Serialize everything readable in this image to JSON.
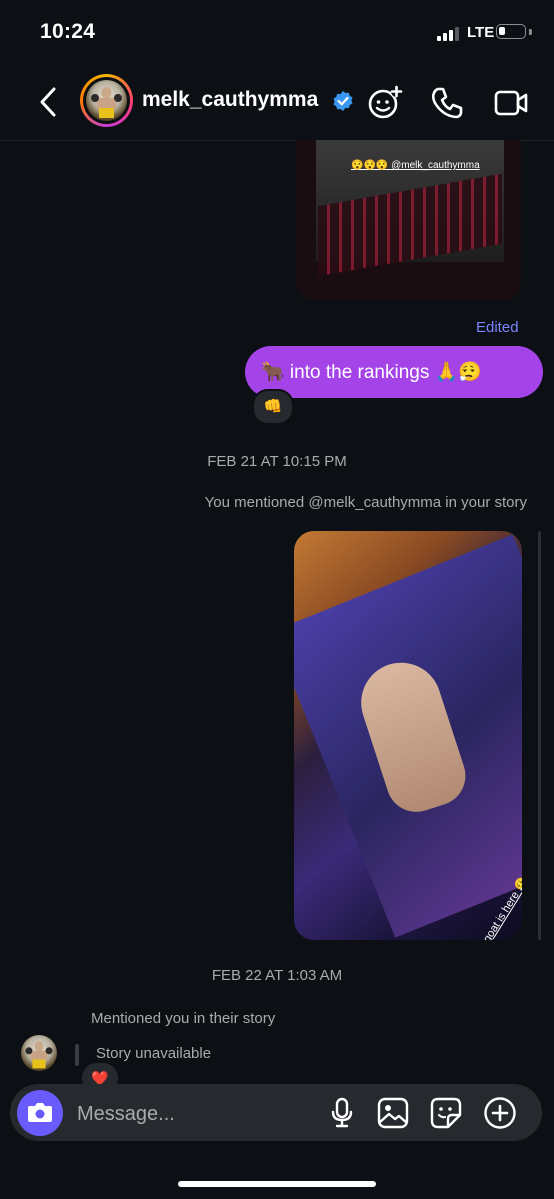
{
  "status_bar": {
    "time": "10:24",
    "network": "LTE",
    "signal_bars": 3,
    "battery_level_pct": 20
  },
  "header": {
    "contact_name": "melk_cauthymma",
    "verified": true,
    "icons": [
      "chevron-left-icon",
      "effects-icon",
      "phone-icon",
      "video-camera-icon"
    ]
  },
  "thread": {
    "story1_caption": "😯😯😯 @melk_cauthymma",
    "edited_label": "Edited",
    "sent_message": "🐂 into the rankings 🙏😮‍💨",
    "reaction_1": "👊",
    "timestamp_1": "FEB 21 AT 10:15 PM",
    "mention_note": "You mentioned @melk_cauthymma in your story",
    "story2_caption": "your goat is here 😮‍💨 @melk_cauthymma",
    "timestamp_2": "FEB 22 AT 1:03 AM",
    "their_mention_note": "Mentioned you in their story",
    "story_unavailable": "Story unavailable",
    "reaction_2": "❤️"
  },
  "composer": {
    "placeholder": "Message...",
    "icons": [
      "camera-icon",
      "microphone-icon",
      "gallery-icon",
      "sticker-icon",
      "plus-icon"
    ]
  },
  "colors": {
    "background": "#0c1014",
    "bubble_sent": "#a443e8",
    "accent": "#6a5bff",
    "edited": "#7a85ff"
  }
}
